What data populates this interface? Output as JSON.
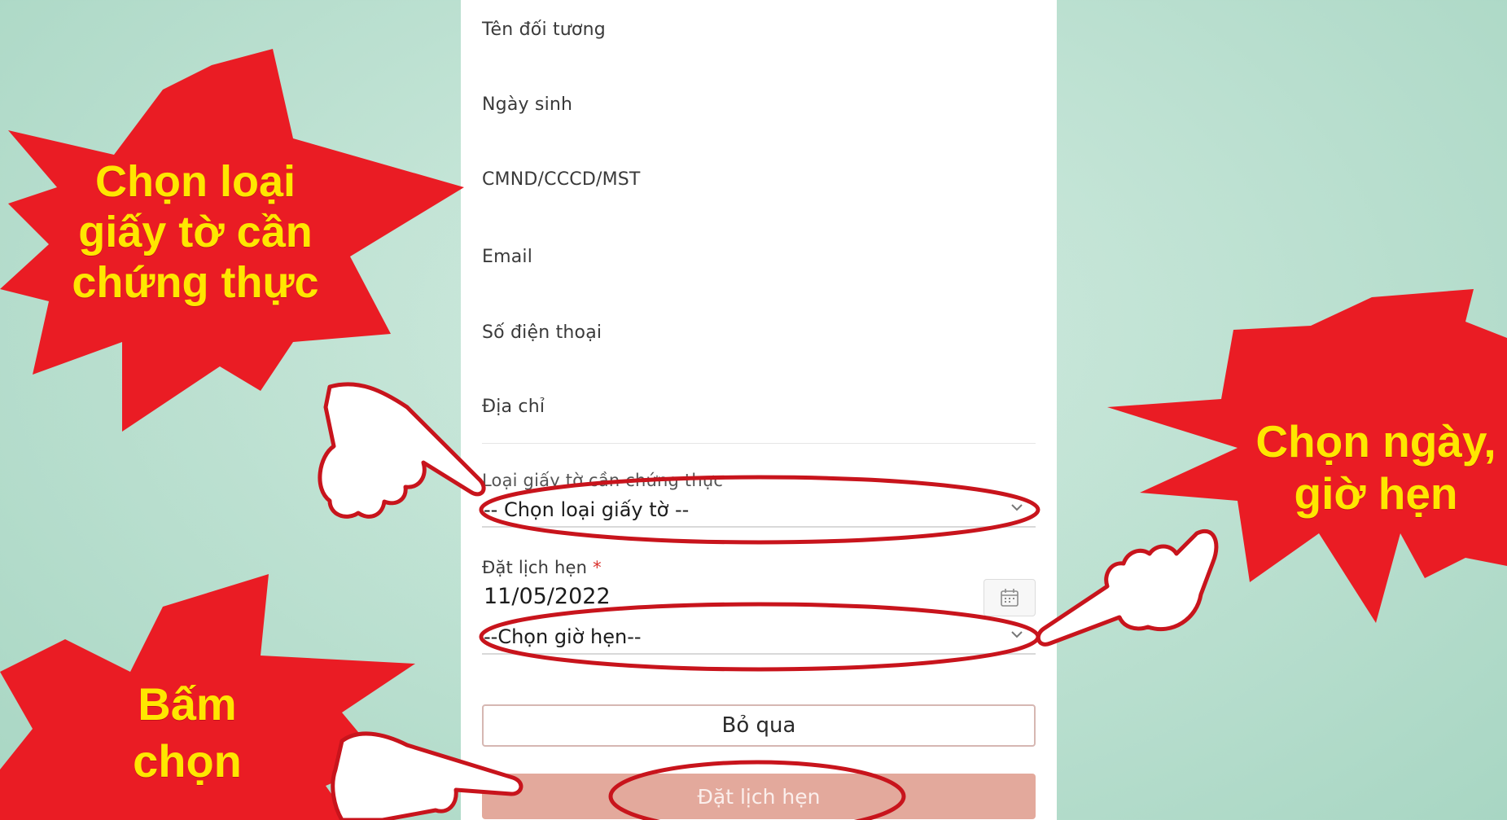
{
  "form": {
    "fields": [
      {
        "label": "Tên đối tương"
      },
      {
        "label": "Ngày sinh"
      },
      {
        "label": "CMND/CCCD/MST"
      },
      {
        "label": "Email"
      },
      {
        "label": "Số điện thoại"
      },
      {
        "label": "Địa chỉ"
      }
    ],
    "doc_type": {
      "label": "Loại giấy tờ cần chứng thực",
      "selected": "-- Chọn loại giấy tờ --"
    },
    "appointment": {
      "label": "Đặt lịch hẹn",
      "required_mark": "*",
      "date_value": "11/05/2022",
      "time_selected": "--Chọn giờ hẹn--"
    },
    "buttons": {
      "skip": "Bỏ qua",
      "book": "Đặt lịch hẹn"
    }
  },
  "callouts": {
    "doc_type": "Chọn loại\ngiấy tờ cần\nchứng thực",
    "datetime": "Chọn ngày,\ngiờ hẹn",
    "submit": "Bấm\nchọn"
  },
  "colors": {
    "background": "#bfe2d3",
    "burst": "#ea1c24",
    "callout_text": "#ffe600",
    "annotation": "#c8141c",
    "book_button": "#e3a99c"
  },
  "icons": {
    "calendar": "calendar-icon",
    "chevron": "chevron-down-icon",
    "pointer": "pointing-hand-icon"
  }
}
